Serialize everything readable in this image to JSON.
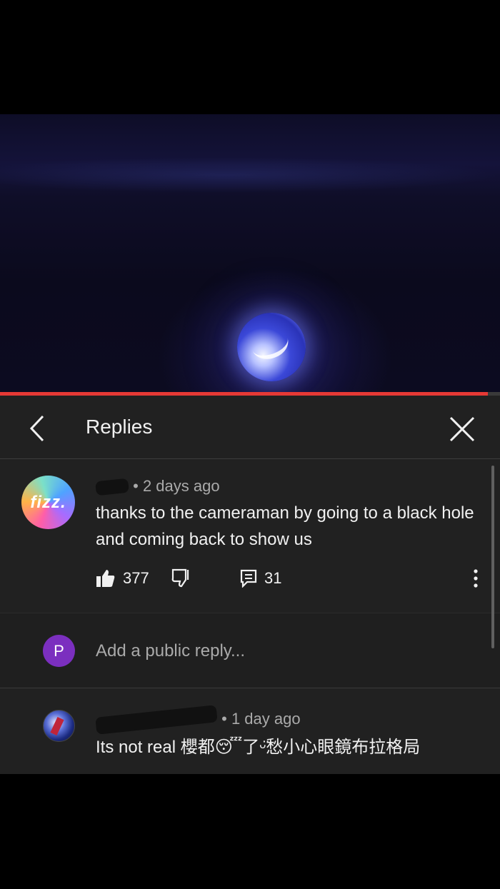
{
  "video": {
    "progress_fraction": 0.976
  },
  "header": {
    "title": "Replies",
    "back_icon": "chevron-left-icon",
    "close_icon": "close-icon"
  },
  "comment": {
    "avatar_text": "fizz.",
    "time": "2 days ago",
    "separator": "•",
    "text": "thanks to the cameraman by going to a black hole and coming back to show us",
    "likes": "377",
    "replies": "31"
  },
  "reply_box": {
    "avatar_letter": "P",
    "placeholder": "Add a public reply..."
  },
  "reply": {
    "separator": "•",
    "time": "1 day ago",
    "text": "Its not real 櫻都😴了ᵕ̈愁小心眼鏡布拉格局"
  },
  "colors": {
    "accent_red": "#e53935",
    "panel_bg": "#212121",
    "avatar_p": "#7b2fbf"
  }
}
